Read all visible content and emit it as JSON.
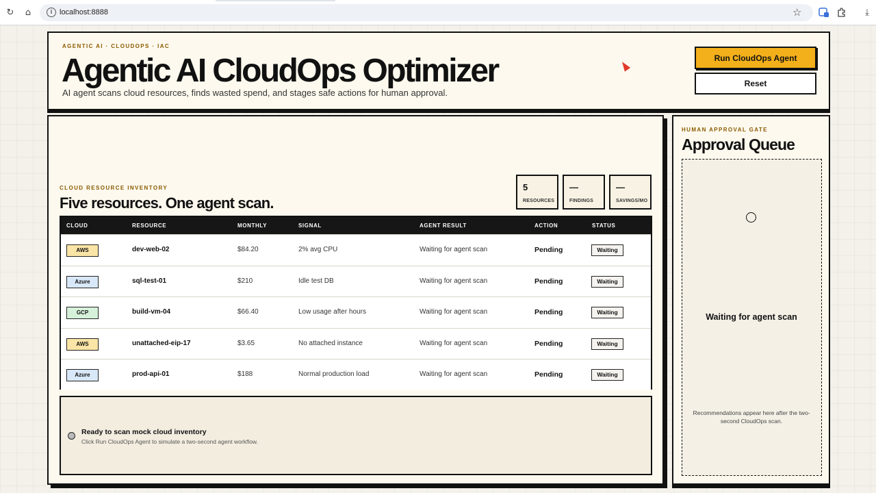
{
  "browser": {
    "url": "localhost:8888",
    "url_info": "i",
    "reload_glyph": "↻",
    "home_glyph": "⌂",
    "star_glyph": "☆",
    "download_glyph": "⤓"
  },
  "header": {
    "eyebrow": "AGENTIC AI · CLOUDOPS · IAC",
    "title": "Agentic AI CloudOps Optimizer",
    "subtitle": "AI agent scans cloud resources, finds wasted spend, and stages safe actions for human approval.",
    "run_label": "Run CloudOps Agent",
    "reset_label": "Reset"
  },
  "inventory": {
    "eyebrow": "CLOUD RESOURCE INVENTORY",
    "title": "Five resources. One agent scan.",
    "stats": [
      {
        "value": "5",
        "label": "RESOURCES"
      },
      {
        "value": "—",
        "label": "FINDINGS"
      },
      {
        "value": "—",
        "label": "SAVINGS/MO"
      }
    ],
    "columns": [
      "CLOUD",
      "RESOURCE",
      "MONTHLY",
      "SIGNAL",
      "AGENT RESULT",
      "ACTION",
      "STATUS"
    ],
    "rows": [
      {
        "cloud": "AWS",
        "cloud_class": "aws",
        "resource": "dev-web-02",
        "monthly": "$84.20",
        "signal": "2% avg CPU",
        "result": "Waiting for agent scan",
        "action": "Pending",
        "status": "Waiting"
      },
      {
        "cloud": "Azure",
        "cloud_class": "azure",
        "resource": "sql-test-01",
        "monthly": "$210",
        "signal": "Idle test DB",
        "result": "Waiting for agent scan",
        "action": "Pending",
        "status": "Waiting"
      },
      {
        "cloud": "GCP",
        "cloud_class": "gcp",
        "resource": "build-vm-04",
        "monthly": "$66.40",
        "signal": "Low usage after hours",
        "result": "Waiting for agent scan",
        "action": "Pending",
        "status": "Waiting"
      },
      {
        "cloud": "AWS",
        "cloud_class": "aws",
        "resource": "unattached-eip-17",
        "monthly": "$3.65",
        "signal": "No attached instance",
        "result": "Waiting for agent scan",
        "action": "Pending",
        "status": "Waiting"
      },
      {
        "cloud": "Azure",
        "cloud_class": "azure",
        "resource": "prod-api-01",
        "monthly": "$188",
        "signal": "Normal production load",
        "result": "Waiting for agent scan",
        "action": "Pending",
        "status": "Waiting"
      }
    ],
    "status": {
      "title": "Ready to scan mock cloud inventory",
      "subtitle": "Click Run CloudOps Agent to simulate a two-second agent workflow."
    }
  },
  "approval": {
    "eyebrow": "HUMAN APPROVAL GATE",
    "title": "Approval Queue",
    "empty_title": "Waiting for agent scan",
    "empty_subtitle": "Recommendations appear here after the two-second CloudOps scan."
  },
  "colors": {
    "accent": "#f3b01a",
    "eyebrow": "#8a5a00",
    "ink": "#111111",
    "panel": "#fdf9ee",
    "aws_chip": "#fbe5a6",
    "azure_chip": "#d9e8f8",
    "gcp_chip": "#d6f1d9"
  }
}
